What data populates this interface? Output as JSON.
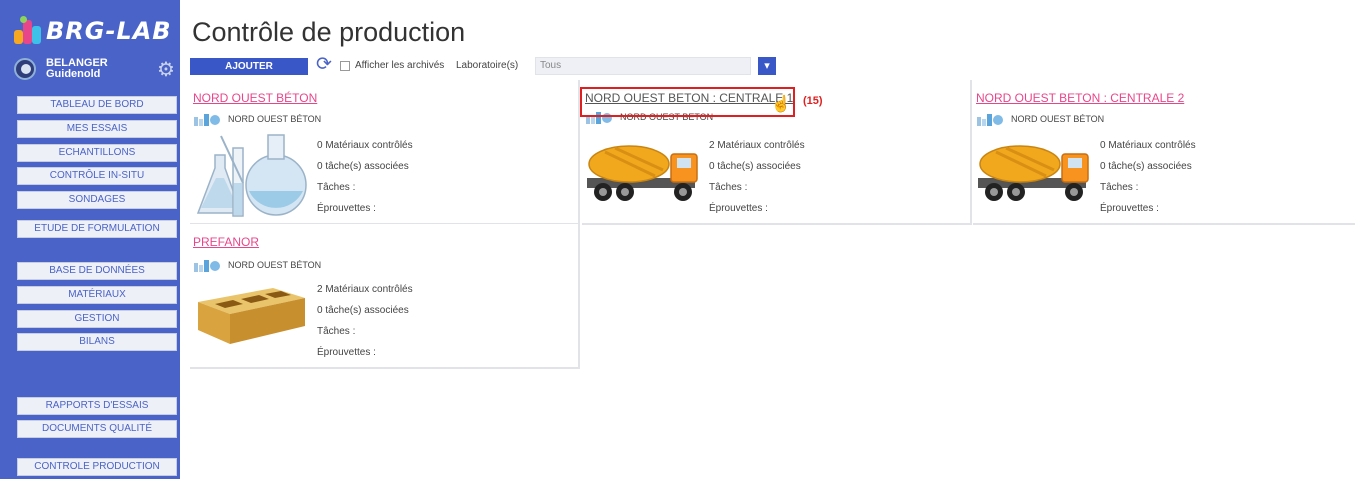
{
  "app": {
    "name": "BRG-LAB"
  },
  "user": {
    "lastname": "BELANGER",
    "firstname": "Guidenold"
  },
  "nav": [
    {
      "label": "TABLEAU DE BORD"
    },
    {
      "label": "MES ESSAIS"
    },
    {
      "label": "ECHANTILLONS"
    },
    {
      "label": "CONTRÔLE IN-SITU"
    },
    {
      "label": "SONDAGES"
    },
    {
      "label": "ETUDE DE FORMULATION"
    },
    {
      "label": "BASE DE DONNÉES"
    },
    {
      "label": "MATÉRIAUX"
    },
    {
      "label": "GESTION"
    },
    {
      "label": "BILANS"
    },
    {
      "label": "RAPPORTS D'ESSAIS"
    },
    {
      "label": "DOCUMENTS QUALITÉ"
    },
    {
      "label": "CONTROLE PRODUCTION"
    }
  ],
  "page": {
    "title": "Contrôle de production"
  },
  "toolbar": {
    "add_label": "AJOUTER",
    "archived_label": "Afficher les archivés",
    "lab_label": "Laboratoire(s)",
    "lab_value": "Tous"
  },
  "cards": [
    {
      "title": "NORD OUEST BÉTON",
      "org": "NORD OUEST BÉTON",
      "image": "laboratory-glassware",
      "materials": "0 Matériaux contrôlés",
      "tasks": "0 tâche(s) associées",
      "tasks_label": "Tâches :",
      "specimens_label": "Éprouvettes :"
    },
    {
      "title": "NORD OUEST BETON : CENTRALE 1",
      "org": "NORD OUEST BETON",
      "image": "concrete-mixer-truck",
      "materials": "2 Matériaux contrôlés",
      "tasks": "0 tâche(s) associées",
      "tasks_label": "Tâches :",
      "specimens_label": "Éprouvettes :"
    },
    {
      "title": "NORD OUEST BETON : CENTRALE 2",
      "org": "NORD OUEST BÉTON",
      "image": "concrete-mixer-truck",
      "materials": "0 Matériaux contrôlés",
      "tasks": "0 tâche(s) associées",
      "tasks_label": "Tâches :",
      "specimens_label": "Éprouvettes :"
    },
    {
      "title": "PREFANOR",
      "org": "NORD OUEST BÉTON",
      "image": "concrete-block",
      "materials": "2 Matériaux contrôlés",
      "tasks": "0 tâche(s) associées",
      "tasks_label": "Tâches :",
      "specimens_label": "Éprouvettes :"
    }
  ],
  "annotation": {
    "label": "(15)"
  },
  "colors": {
    "sidebar": "#4a63c8",
    "accent": "#3a57c8",
    "link": "#e8468a",
    "highlight": "#e02020"
  }
}
